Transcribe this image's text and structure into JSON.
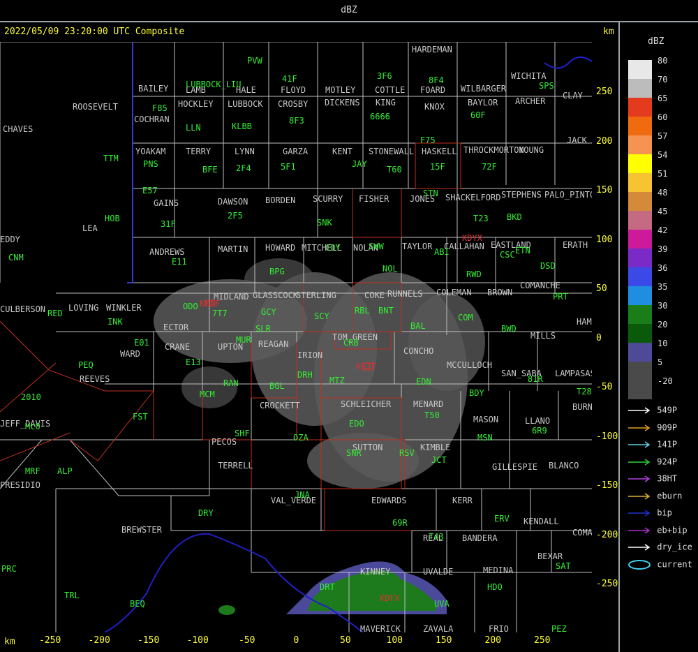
{
  "header": {
    "title": "dBZ"
  },
  "map": {
    "timestamp": "2022/05/09 23:20:00 UTC Composite",
    "km_label_top": "km",
    "km_label_bottom": "km",
    "y_ticks": [
      "250",
      "200",
      "150",
      "100",
      "50",
      "0",
      "-50",
      "-100",
      "-150",
      "-200",
      "-250"
    ],
    "x_ticks": [
      "-250",
      "-200",
      "-150",
      "-100",
      "-50",
      "0",
      "50",
      "100",
      "150",
      "200",
      "250"
    ],
    "county_labels": [
      "HARDEMAN",
      "WICHITA",
      "CLAY",
      "BAILEY",
      "LAMB",
      "HALE",
      "FLOYD",
      "MOTLEY",
      "COTTLE",
      "FOARD",
      "WILBARGER",
      "ARCHER",
      "ROOSEVELT",
      "HOCKLEY",
      "LUBBOCK",
      "CROSBY",
      "DICKENS",
      "KING",
      "KNOX",
      "BAYLOR",
      "COCHRAN",
      "CHAVES",
      "JACK",
      "YOAKAM",
      "TERRY",
      "LYNN",
      "GARZA",
      "KENT",
      "STONEWALL",
      "HASKELL",
      "THROCKMORTON",
      "YOUNG",
      "GAINS",
      "DAWSON",
      "BORDEN",
      "SCURRY",
      "FISHER",
      "JONES",
      "SHACKELFORD",
      "STEPHENS",
      "PALO_PINTO",
      "LEA",
      "EDDY",
      "ANDREWS",
      "MARTIN",
      "HOWARD",
      "MITCHELL",
      "NOLAN",
      "TAYLOR",
      "CALLAHAN",
      "EASTLAND",
      "ERATH",
      "COMANCHE",
      "LOVING",
      "WINKLER",
      "MIDLAND",
      "GLASSCOCK",
      "STERLING",
      "COKE",
      "RUNNELS",
      "COLEMAN",
      "BROWN",
      "HAMILTON",
      "ECTOR",
      "WARD",
      "CRANE",
      "UPTON",
      "REAGAN",
      "IRION",
      "TOM_GREEN",
      "CONCHO",
      "MCCULLOCH",
      "MILLS",
      "SAN_SABA",
      "LAMPASAS",
      "REEVES",
      "CROCKETT",
      "SCHLEICHER",
      "MENARD",
      "MASON",
      "LLANO",
      "BURNET",
      "PECOS",
      "TERRELL",
      "SUTTON",
      "KIMBLE",
      "GILLESPIE",
      "BLANCO",
      "VAL_VERDE",
      "EDWARDS",
      "KERR",
      "KENDALL",
      "COMAL",
      "BREWSTER",
      "REAL",
      "BANDERA",
      "BEXAR",
      "KINNEY",
      "UVALDE",
      "MEDINA",
      "MAVERICK",
      "ZAVALA",
      "FRIO",
      "PRESIDIO",
      "JEFF_DAVIS",
      "CULBERSON"
    ],
    "station_ids": [
      "PVW",
      "LUBBOCK_LIU",
      "41F",
      "3F6",
      "8F4",
      "SPS",
      "F85",
      "LLN",
      "KLBB",
      "8F3",
      "6666",
      "60F",
      "F75",
      "TTM",
      "PNS",
      "BFE",
      "2F4",
      "5F1",
      "JAY",
      "T60",
      "15F",
      "72F",
      "E57",
      "31F",
      "2F5",
      "SNK",
      "SWW",
      "STN",
      "T23",
      "BKD",
      "HOB",
      "CNM",
      "E11",
      "BPG",
      "COY",
      "NOL",
      "ABI",
      "CSC",
      "ETN",
      "RWD",
      "DSD",
      "ODO",
      "7T7",
      "GCY",
      "SLR",
      "SCY",
      "RBL",
      "BNT",
      "BAL",
      "COM",
      "PRT",
      "RED",
      "INK",
      "E01",
      "MUR",
      "CRB",
      "BWD",
      "E13",
      "RAN",
      "BGL",
      "DRH",
      "MTZ",
      "EDN",
      "BDY",
      "81R",
      "T28",
      "PEQ",
      "MCM",
      "2010",
      "FST",
      "SHF",
      "EDO",
      "T50",
      "MSN",
      "6R9",
      "OZA",
      "SNR",
      "RSV",
      "JCT",
      "McO",
      "MRF",
      "ALP",
      "DRY",
      "JNA",
      "69R",
      "ERV",
      "T43",
      "PRC",
      "TRL",
      "BEQ",
      "DRT",
      "HDO",
      "SAT",
      "UVA",
      "PEZ"
    ],
    "radar_ids": [
      "KMAF",
      "KSJT",
      "KDFX",
      "KDYX"
    ]
  },
  "legend": {
    "title": "dBZ",
    "scale": [
      {
        "label": "80",
        "color": "#e8e8e8"
      },
      {
        "label": "70",
        "color": "#bcbcbc"
      },
      {
        "label": "65",
        "color": "#e43a1e"
      },
      {
        "label": "60",
        "color": "#f06a10"
      },
      {
        "label": "57",
        "color": "#f59352"
      },
      {
        "label": "54",
        "color": "#ffff00"
      },
      {
        "label": "51",
        "color": "#f6c432"
      },
      {
        "label": "48",
        "color": "#d48a3a"
      },
      {
        "label": "45",
        "color": "#c46a82"
      },
      {
        "label": "42",
        "color": "#cc1a9a"
      },
      {
        "label": "39",
        "color": "#7a2ac6"
      },
      {
        "label": "36",
        "color": "#3b4ae6"
      },
      {
        "label": "35",
        "color": "#1f8de0"
      },
      {
        "label": "30",
        "color": "#1a7d1a"
      },
      {
        "label": "20",
        "color": "#0b5a0b"
      },
      {
        "label": "10",
        "color": "#4e4a98"
      },
      {
        "label": "5",
        "color": "#4a4a4a"
      },
      {
        "label": "-20",
        "color": "#4a4a4a"
      }
    ],
    "lines": [
      {
        "label": "549P",
        "color": "#ffffff",
        "icon": "arrow-icon"
      },
      {
        "label": "909P",
        "color": "#e0a020",
        "icon": "arrow-icon"
      },
      {
        "label": "141P",
        "color": "#60d0e0",
        "icon": "arrow-icon"
      },
      {
        "label": "924P",
        "color": "#30d030",
        "icon": "arrow-icon"
      },
      {
        "label": "38HT",
        "color": "#b040e0",
        "icon": "arrow-icon"
      },
      {
        "label": "eburn",
        "color": "#e0b030",
        "icon": "arrow-icon"
      },
      {
        "label": "bip",
        "color": "#2030d0",
        "icon": "arrow-icon"
      },
      {
        "label": "eb+bip",
        "color": "#b030d0",
        "icon": "arrow-icon"
      },
      {
        "label": "dry_ice",
        "color": "#ffffff",
        "icon": "arrow-icon"
      },
      {
        "label": "current",
        "color": "#40d0f0",
        "icon": "ellipse-icon"
      }
    ]
  }
}
